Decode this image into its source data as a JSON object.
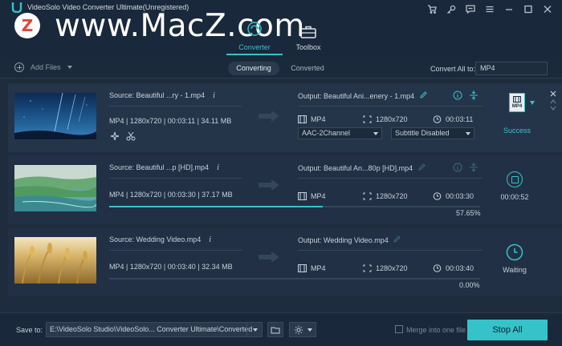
{
  "app": {
    "title": "VideoSolo Video Converter Ultimate(Unregistered)",
    "watermark_badge": "Z",
    "watermark_text": "www.MacZ.com",
    "accent": "#36c2c9"
  },
  "window_icons": [
    "cart-icon",
    "key-icon",
    "feedback-icon",
    "menu-icon",
    "minimize-icon",
    "maximize-icon",
    "close-icon"
  ],
  "nav": {
    "converter": "Converter",
    "toolbox": "Toolbox"
  },
  "toolbar": {
    "add_files": "Add Files",
    "converting": "Converting",
    "converted": "Converted",
    "convert_all_label": "Convert All to:",
    "convert_all_value": "MP4"
  },
  "rows": [
    {
      "source": "Source: Beautiful ...ry - 1.mp4",
      "meta": "MP4 | 1280x720 | 00:03:11 | 34.11 MB",
      "output": "Output: Beautiful Ani...enery - 1.mp4",
      "format": "MP4",
      "resolution": "1280x720",
      "duration": "00:03:11",
      "audio": "AAC-2Channel",
      "subtitle": "Subtitle Disabled",
      "format_badge": "MP4",
      "status": "Success"
    },
    {
      "source": "Source: Beautiful ...p [HD].mp4",
      "meta": "MP4 | 1280x720 | 00:03:30 | 37.17 MB",
      "output": "Output: Beautiful An...80p [HD].mp4",
      "format": "MP4",
      "resolution": "1280x720",
      "duration": "00:03:30",
      "progress": 0.5765,
      "percent": "57.65%",
      "status": "00:00:52"
    },
    {
      "source": "Source: Wedding Video.mp4",
      "meta": "MP4 | 1280x720 | 00:03:40 | 32.34 MB",
      "output": "Output: Wedding Video.mp4",
      "format": "MP4",
      "resolution": "1280x720",
      "duration": "00:03:40",
      "progress": 0,
      "percent": "0.00%",
      "status": "Waiting"
    }
  ],
  "bottom": {
    "save_to": "Save to:",
    "path": "E:\\VideoSolo Studio\\VideoSolo... Converter Ultimate\\Converted",
    "merge": "Merge into one file",
    "stop_all": "Stop All"
  }
}
